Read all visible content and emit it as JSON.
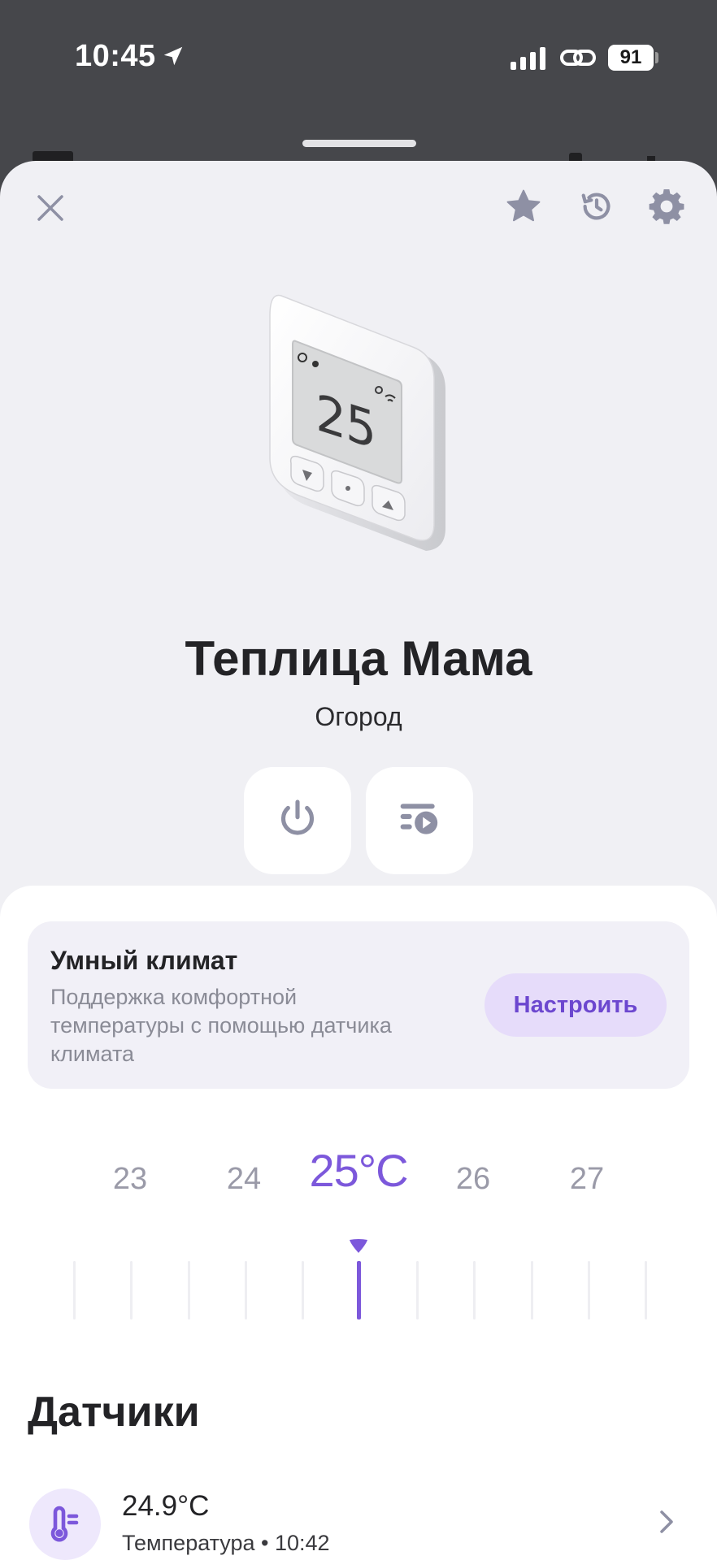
{
  "status_bar": {
    "time": "10:45",
    "battery": "91"
  },
  "device": {
    "name": "Теплица Мама",
    "room": "Огород",
    "display_temp": "25"
  },
  "header_icons": [
    "close-icon",
    "star-icon",
    "history-icon",
    "gear-icon"
  ],
  "actions": [
    "power-icon",
    "scenario-icon"
  ],
  "smart_climate": {
    "title": "Умный климат",
    "description": "Поддержка комфортной температуры с помощью датчика климата",
    "button_label": "Настроить"
  },
  "temperature_picker": {
    "left2": "23",
    "left1": "24",
    "current": "25°C",
    "right1": "26",
    "right2": "27",
    "selected_value": 25
  },
  "sensors": {
    "title": "Датчики",
    "items": [
      {
        "value": "24.9°C",
        "meta": "Температура • 10:42",
        "icon": "thermometer-icon"
      }
    ]
  },
  "colors": {
    "accent": "#7c58db",
    "sheet_bg": "#f0f0f4",
    "panel_bg": "#ffffff",
    "card_bg": "#f1f0f7",
    "button_bg": "#e6dcfa",
    "icon_grey": "#8e90a4"
  }
}
